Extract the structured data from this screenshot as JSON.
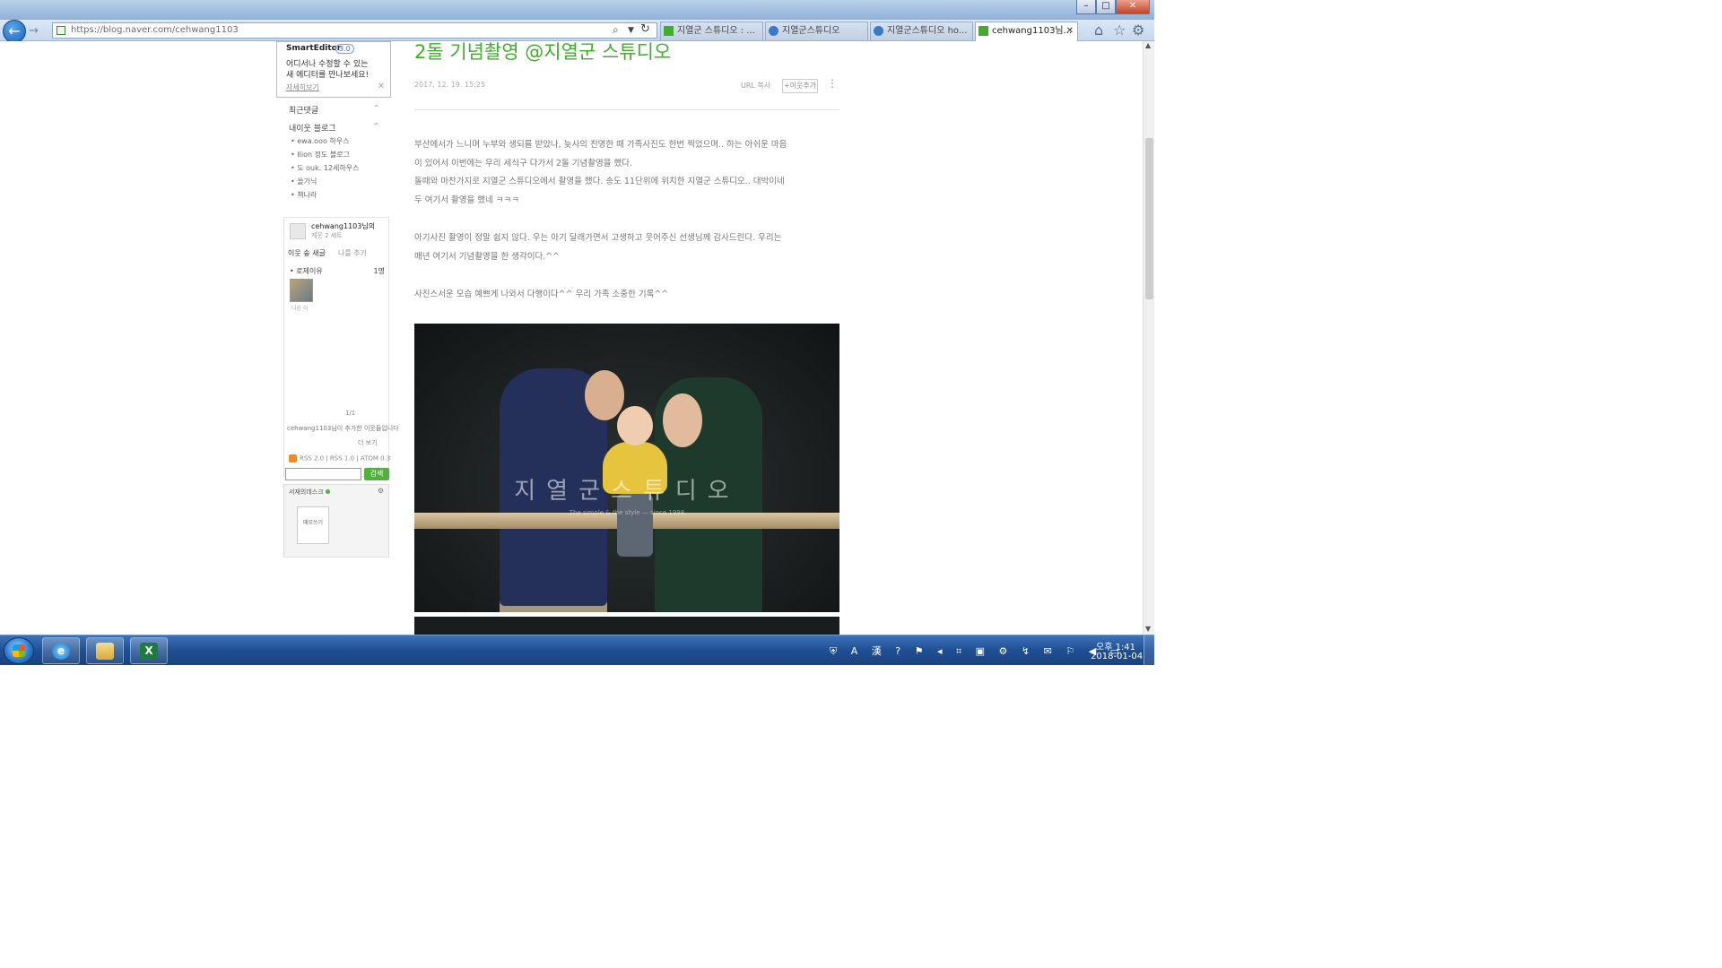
{
  "browser": {
    "url": "https://blog.naver.com/cehwang1103",
    "tabs": [
      {
        "label": "지열군 스튜디오 : ...",
        "active": false,
        "color": "#3fae2b"
      },
      {
        "label": "지열군스튜디오",
        "active": false,
        "color": "#3a78c9"
      },
      {
        "label": "지열군스튜디오 ho...",
        "active": false,
        "color": "#3a78c9"
      },
      {
        "label": "cehwang1103님...",
        "active": true,
        "color": "#3fae2b"
      }
    ],
    "window_controls": {
      "minimize": "–",
      "maximize": "□",
      "close": "✕"
    }
  },
  "sidebar": {
    "smarteditor": {
      "title": "SmartEditor",
      "badge": "3.0",
      "line1": "어디서나 수정할 수 있는",
      "line2": "새 에디터를 만나보세요!",
      "link": "자세히보기"
    },
    "recent_comments": "최근댓글",
    "neighbor_posts": "내이웃 블로그",
    "neighbor_list": [
      "• ewa.ooo 하우스",
      "• Ilion 정도 블로그",
      "• 도 ouk. 12세하우스",
      "• 올가닉",
      "• 책나라"
    ],
    "profile": {
      "name": "cehwang1103님의",
      "sub": "게웃 2 세트",
      "tab_active": "이웃 숲 새글",
      "tab_inactive": "나를 추가",
      "row_label": "• 로제이유",
      "row_count": "1명",
      "thumb_caption": "다른 이",
      "pager": "1/1",
      "buddy_text": "cehwang1103님이 추가한 이웃들입니다",
      "buddy_more": "더 보기"
    },
    "rss": "RSS 2.0  |  RSS 1.0  |  ATOM 0.3",
    "search_button": "검색",
    "desk": {
      "title": "서재의데스크",
      "note": "메모쓰기"
    }
  },
  "post": {
    "title": "2돌 기념촬영 @지열군 스튜디오",
    "date": "2017. 12. 19. 15:25",
    "url_copy": "URL 복사",
    "more": "+이웃추가",
    "kebab": "⋮",
    "paragraphs": [
      "부산에서가 느니며 누부와 생되를 받았나, 늦사의 친영한 때 가족사진도 한번 찍었으며.. 하는 아쉬운 마음",
      "이 있어서 이번에는 우리 세식구 다가서 2돌 기념촬영을 했다.",
      "돌때와 마찬가지로 지열군 스튜디오에서 촬영을 했다. 송도 11단위에 위치한 지열군 스튜디오.. 대박이네",
      "두 여기서 촬영을 했네 ㅋㅋㅋ",
      "아기사진 촬영이 정말 쉽지 않다. 우는 아기 달래가면서 고생하고 웃어주신 선생님께 감사드린다. 우리는",
      "매년 여기서 기념촬영을 한 생각이다.^^",
      "사진스서운 모습 예쁘게 나와서 다행이다^^ 우리 가족 소중한 기록^^"
    ],
    "photo_watermark": "지열군스튜디오",
    "photo_watermark_sub": "The simple & the style — since 1998"
  },
  "taskbar": {
    "tray": "⛨ A 漢 ? ⚑ ◂ ⌗ ▣ ⚙ ↯ ✉ ⚐ ◀ ▭",
    "time": "오후 1:41",
    "date": "2018-01-04",
    "excel_label": "X"
  },
  "icons": {
    "back": "back-arrow-icon",
    "forward": "forward-arrow-icon",
    "search": "search-icon",
    "refresh": "refresh-icon",
    "home": "home-icon",
    "favorites": "star-icon",
    "tools": "gear-icon"
  }
}
